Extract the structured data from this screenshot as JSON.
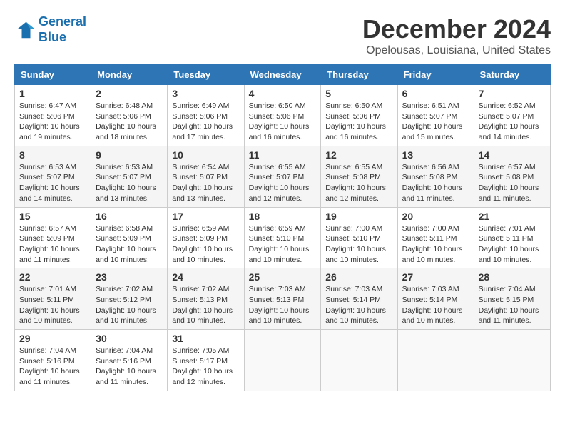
{
  "header": {
    "logo_line1": "General",
    "logo_line2": "Blue",
    "month_year": "December 2024",
    "location": "Opelousas, Louisiana, United States"
  },
  "weekdays": [
    "Sunday",
    "Monday",
    "Tuesday",
    "Wednesday",
    "Thursday",
    "Friday",
    "Saturday"
  ],
  "weeks": [
    [
      {
        "day": "1",
        "info": "Sunrise: 6:47 AM\nSunset: 5:06 PM\nDaylight: 10 hours\nand 19 minutes."
      },
      {
        "day": "2",
        "info": "Sunrise: 6:48 AM\nSunset: 5:06 PM\nDaylight: 10 hours\nand 18 minutes."
      },
      {
        "day": "3",
        "info": "Sunrise: 6:49 AM\nSunset: 5:06 PM\nDaylight: 10 hours\nand 17 minutes."
      },
      {
        "day": "4",
        "info": "Sunrise: 6:50 AM\nSunset: 5:06 PM\nDaylight: 10 hours\nand 16 minutes."
      },
      {
        "day": "5",
        "info": "Sunrise: 6:50 AM\nSunset: 5:06 PM\nDaylight: 10 hours\nand 16 minutes."
      },
      {
        "day": "6",
        "info": "Sunrise: 6:51 AM\nSunset: 5:07 PM\nDaylight: 10 hours\nand 15 minutes."
      },
      {
        "day": "7",
        "info": "Sunrise: 6:52 AM\nSunset: 5:07 PM\nDaylight: 10 hours\nand 14 minutes."
      }
    ],
    [
      {
        "day": "8",
        "info": "Sunrise: 6:53 AM\nSunset: 5:07 PM\nDaylight: 10 hours\nand 14 minutes."
      },
      {
        "day": "9",
        "info": "Sunrise: 6:53 AM\nSunset: 5:07 PM\nDaylight: 10 hours\nand 13 minutes."
      },
      {
        "day": "10",
        "info": "Sunrise: 6:54 AM\nSunset: 5:07 PM\nDaylight: 10 hours\nand 13 minutes."
      },
      {
        "day": "11",
        "info": "Sunrise: 6:55 AM\nSunset: 5:07 PM\nDaylight: 10 hours\nand 12 minutes."
      },
      {
        "day": "12",
        "info": "Sunrise: 6:55 AM\nSunset: 5:08 PM\nDaylight: 10 hours\nand 12 minutes."
      },
      {
        "day": "13",
        "info": "Sunrise: 6:56 AM\nSunset: 5:08 PM\nDaylight: 10 hours\nand 11 minutes."
      },
      {
        "day": "14",
        "info": "Sunrise: 6:57 AM\nSunset: 5:08 PM\nDaylight: 10 hours\nand 11 minutes."
      }
    ],
    [
      {
        "day": "15",
        "info": "Sunrise: 6:57 AM\nSunset: 5:09 PM\nDaylight: 10 hours\nand 11 minutes."
      },
      {
        "day": "16",
        "info": "Sunrise: 6:58 AM\nSunset: 5:09 PM\nDaylight: 10 hours\nand 10 minutes."
      },
      {
        "day": "17",
        "info": "Sunrise: 6:59 AM\nSunset: 5:09 PM\nDaylight: 10 hours\nand 10 minutes."
      },
      {
        "day": "18",
        "info": "Sunrise: 6:59 AM\nSunset: 5:10 PM\nDaylight: 10 hours\nand 10 minutes."
      },
      {
        "day": "19",
        "info": "Sunrise: 7:00 AM\nSunset: 5:10 PM\nDaylight: 10 hours\nand 10 minutes."
      },
      {
        "day": "20",
        "info": "Sunrise: 7:00 AM\nSunset: 5:11 PM\nDaylight: 10 hours\nand 10 minutes."
      },
      {
        "day": "21",
        "info": "Sunrise: 7:01 AM\nSunset: 5:11 PM\nDaylight: 10 hours\nand 10 minutes."
      }
    ],
    [
      {
        "day": "22",
        "info": "Sunrise: 7:01 AM\nSunset: 5:11 PM\nDaylight: 10 hours\nand 10 minutes."
      },
      {
        "day": "23",
        "info": "Sunrise: 7:02 AM\nSunset: 5:12 PM\nDaylight: 10 hours\nand 10 minutes."
      },
      {
        "day": "24",
        "info": "Sunrise: 7:02 AM\nSunset: 5:13 PM\nDaylight: 10 hours\nand 10 minutes."
      },
      {
        "day": "25",
        "info": "Sunrise: 7:03 AM\nSunset: 5:13 PM\nDaylight: 10 hours\nand 10 minutes."
      },
      {
        "day": "26",
        "info": "Sunrise: 7:03 AM\nSunset: 5:14 PM\nDaylight: 10 hours\nand 10 minutes."
      },
      {
        "day": "27",
        "info": "Sunrise: 7:03 AM\nSunset: 5:14 PM\nDaylight: 10 hours\nand 10 minutes."
      },
      {
        "day": "28",
        "info": "Sunrise: 7:04 AM\nSunset: 5:15 PM\nDaylight: 10 hours\nand 11 minutes."
      }
    ],
    [
      {
        "day": "29",
        "info": "Sunrise: 7:04 AM\nSunset: 5:16 PM\nDaylight: 10 hours\nand 11 minutes."
      },
      {
        "day": "30",
        "info": "Sunrise: 7:04 AM\nSunset: 5:16 PM\nDaylight: 10 hours\nand 11 minutes."
      },
      {
        "day": "31",
        "info": "Sunrise: 7:05 AM\nSunset: 5:17 PM\nDaylight: 10 hours\nand 12 minutes."
      },
      {
        "day": "",
        "info": ""
      },
      {
        "day": "",
        "info": ""
      },
      {
        "day": "",
        "info": ""
      },
      {
        "day": "",
        "info": ""
      }
    ]
  ]
}
